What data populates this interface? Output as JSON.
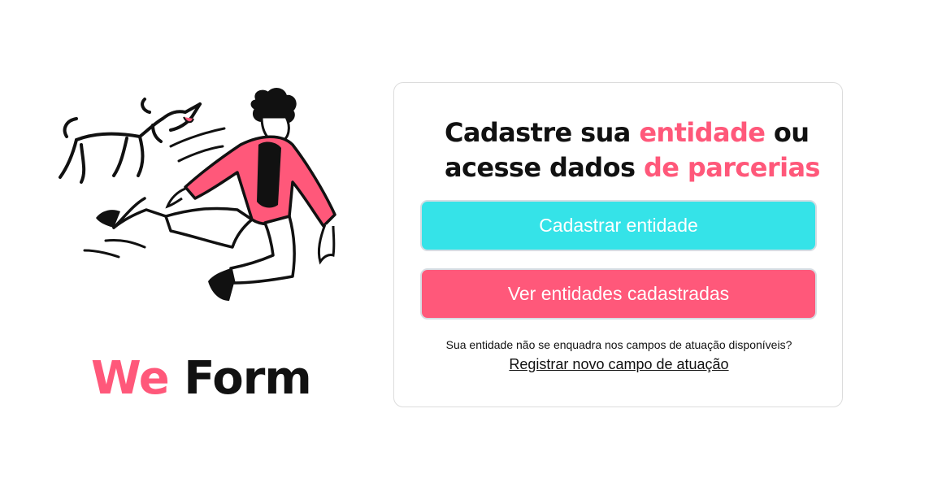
{
  "brand": {
    "first": "We",
    "second": "Form"
  },
  "card": {
    "heading": {
      "part1": "Cadastre sua ",
      "highlight1": "entidade",
      "part2": " ou acesse dados ",
      "highlight2": "de parcerias"
    },
    "register_button": "Cadastrar entidade",
    "view_button": "Ver entidades cadastradas",
    "note": "Sua entidade não se enquadra nos campos de atuação disponíveis?",
    "link": "Registrar novo campo de atuação"
  },
  "colors": {
    "accent_pink": "#ff587a",
    "accent_cyan": "#35e3e8",
    "text": "#111111"
  },
  "illustration": {
    "icon": "person-running-with-dog-illustration"
  }
}
